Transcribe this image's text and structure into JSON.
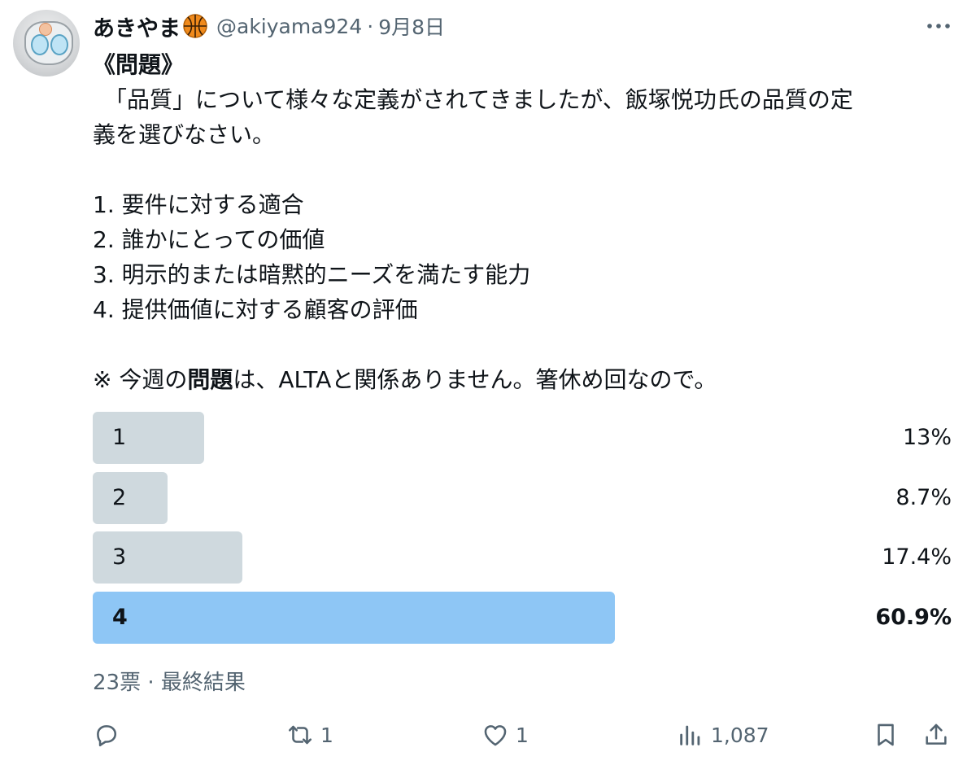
{
  "tweet": {
    "author_name": "あきやま",
    "handle": "@akiyama924",
    "separator": "·",
    "date": "9月8日",
    "avatar_icon": "robot-avatar",
    "name_emoji_icon": "basketball-icon",
    "lines": [
      {
        "type": "bold",
        "text": "《問題》"
      },
      {
        "type": "text",
        "text": "　「品質」について様々な定義がされてきましたが、飯塚悦功氏の品質の定"
      },
      {
        "type": "text",
        "text": "義を選びなさい。"
      },
      {
        "type": "blank",
        "text": ""
      },
      {
        "type": "text",
        "text": "1. 要件に対する適合"
      },
      {
        "type": "text",
        "text": "2. 誰かにとっての価値"
      },
      {
        "type": "text",
        "text": "3. 明示的または暗黙的ニーズを満たす能力"
      },
      {
        "type": "text",
        "text": "4. 提供価値に対する顧客の評価"
      },
      {
        "type": "blank",
        "text": ""
      }
    ],
    "note": {
      "prefix": "※ 今週の",
      "bold": "問題",
      "suffix": "は、ALTAと関係ありません。箸休め回なので。"
    }
  },
  "poll": {
    "options": [
      {
        "label": "1",
        "percent_text": "13%",
        "percent": 13.0,
        "winner": false
      },
      {
        "label": "2",
        "percent_text": "8.7%",
        "percent": 8.7,
        "winner": false
      },
      {
        "label": "3",
        "percent_text": "17.4%",
        "percent": 17.4,
        "winner": false
      },
      {
        "label": "4",
        "percent_text": "60.9%",
        "percent": 60.9,
        "winner": true
      }
    ],
    "summary": "23票 · 最終結果",
    "colors": {
      "bar": "#cfd9de",
      "winner_bar": "#8ec6f5"
    }
  },
  "actions": {
    "reply_count": "",
    "retweet_count": "1",
    "like_count": "1",
    "views_count": "1,087"
  },
  "colors": {
    "text": "#0f1419",
    "muted": "#536471"
  }
}
